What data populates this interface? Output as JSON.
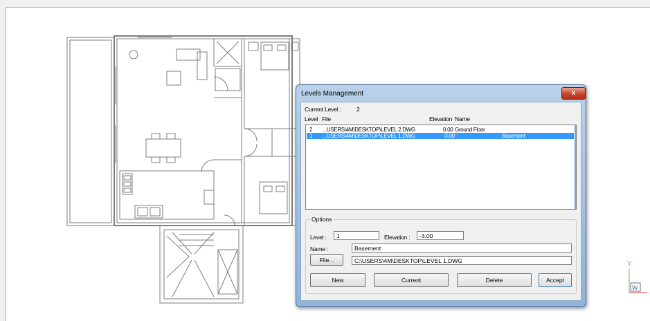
{
  "dialog": {
    "title": "Levels Management",
    "close_label": "x",
    "current_level_label": "Current Level :",
    "current_level_value": "2",
    "columns": {
      "level": "Level",
      "file": "File",
      "elevation": "Elevation",
      "name": "Name"
    },
    "rows": [
      {
        "level": "2",
        "file": "...USERS\\4M\\DESKTOP\\LEVEL 2.DWG",
        "elevation": "0.00",
        "name": "Ground Floor",
        "selected": false
      },
      {
        "level": "1",
        "file": "...USERS\\4M\\DESKTOP\\LEVEL 1.DWG",
        "elevation": "-3.00",
        "name": "Basement",
        "selected": true
      }
    ],
    "options": {
      "legend": "Options",
      "level_label": "Level :",
      "level_value": "1",
      "elevation_label": "Elevation :",
      "elevation_value": "-3.00",
      "name_label": "Name :",
      "name_value": "Basement",
      "file_button": "File...",
      "file_value": "C:\\USERS\\4M\\DESKTOP\\LEVEL 1.DWG"
    },
    "buttons": {
      "new": "New",
      "current": "Current",
      "delete": "Delete",
      "accept": "Accept"
    }
  },
  "ucs": {
    "y_label": "Y",
    "w_label": "W"
  }
}
